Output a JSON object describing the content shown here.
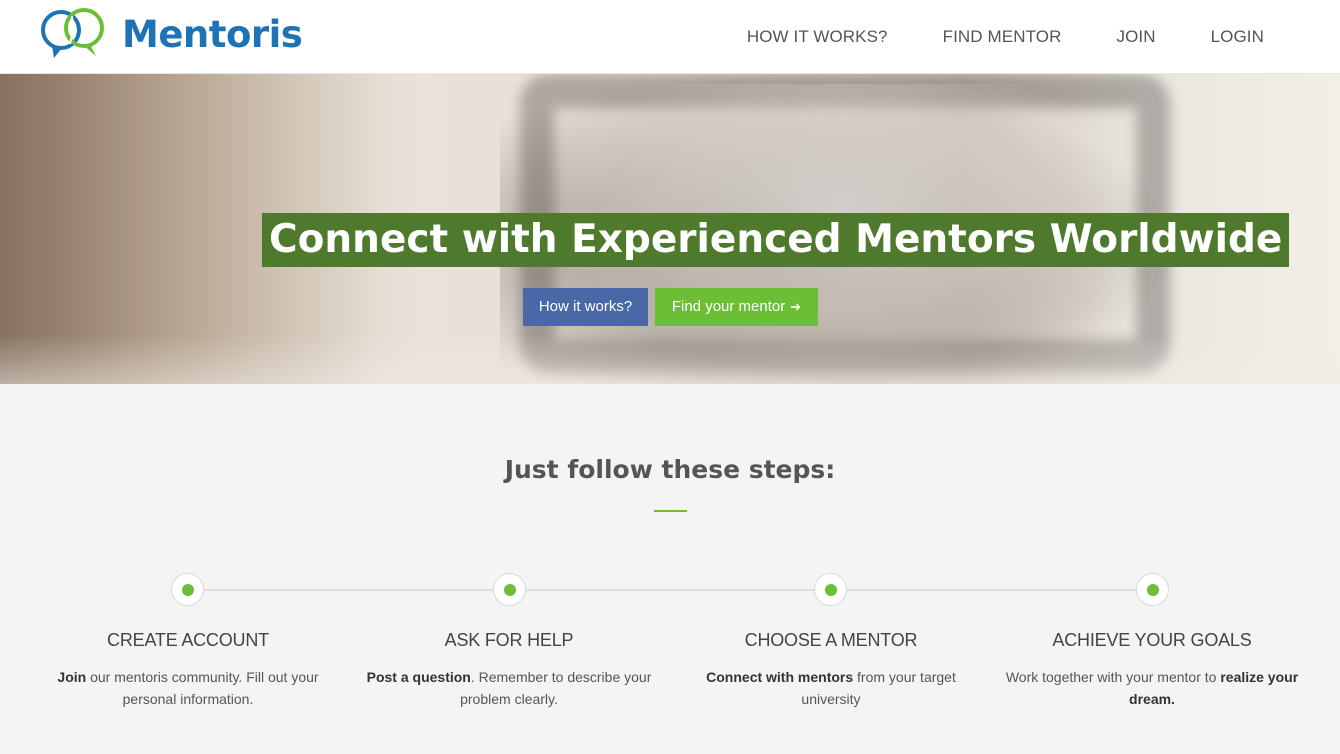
{
  "brand": {
    "name": "Mentoris"
  },
  "nav": {
    "how_it_works": "HOW IT WORKS?",
    "find_mentor": "FIND MENTOR",
    "join": "JOIN",
    "login": "LOGIN"
  },
  "hero": {
    "title": "Connect with Experienced Mentors Worldwide",
    "btn_how": "How it works?",
    "btn_find": "Find your mentor"
  },
  "steps": {
    "heading": "Just follow these steps:",
    "items": [
      {
        "title": "CREATE ACCOUNT",
        "bold": "Join",
        "text": " our mentoris community. Fill out your personal information.",
        "tail_bold": ""
      },
      {
        "title": "ASK FOR HELP",
        "bold": "Post a question",
        "text": ". Remember to describe your problem clearly.",
        "tail_bold": ""
      },
      {
        "title": "CHOOSE A MENTOR",
        "bold": "Connect with mentors",
        "text": " from your target university",
        "tail_bold": ""
      },
      {
        "title": "ACHIEVE YOUR GOALS",
        "bold": "",
        "text": "Work together with your mentor to ",
        "tail_bold": "realize your dream."
      }
    ]
  },
  "colors": {
    "brand_blue": "#1e73b5",
    "accent_green": "#6cbf35",
    "hero_title_bg": "#4f7a2d",
    "button_blue": "#4a67a8"
  }
}
